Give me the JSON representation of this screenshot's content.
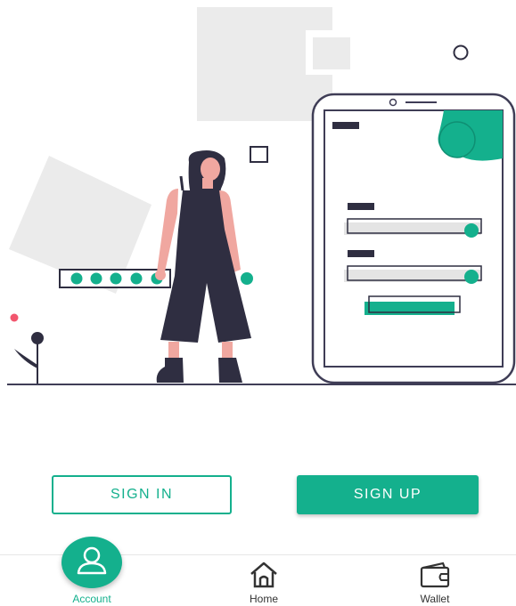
{
  "colors": {
    "accent": "#14b08d",
    "dark": "#2f2e41",
    "skin": "#f0a7a0",
    "light_gray": "#ebebeb",
    "pink_dot": "#f2566e"
  },
  "auth": {
    "sign_in_label": "SIGN IN",
    "sign_up_label": "SIGN UP"
  },
  "nav": {
    "items": [
      {
        "label": "Account",
        "icon": "user-icon",
        "active": true
      },
      {
        "label": "Home",
        "icon": "home-icon",
        "active": false
      },
      {
        "label": "Wallet",
        "icon": "wallet-icon",
        "active": false
      }
    ]
  }
}
